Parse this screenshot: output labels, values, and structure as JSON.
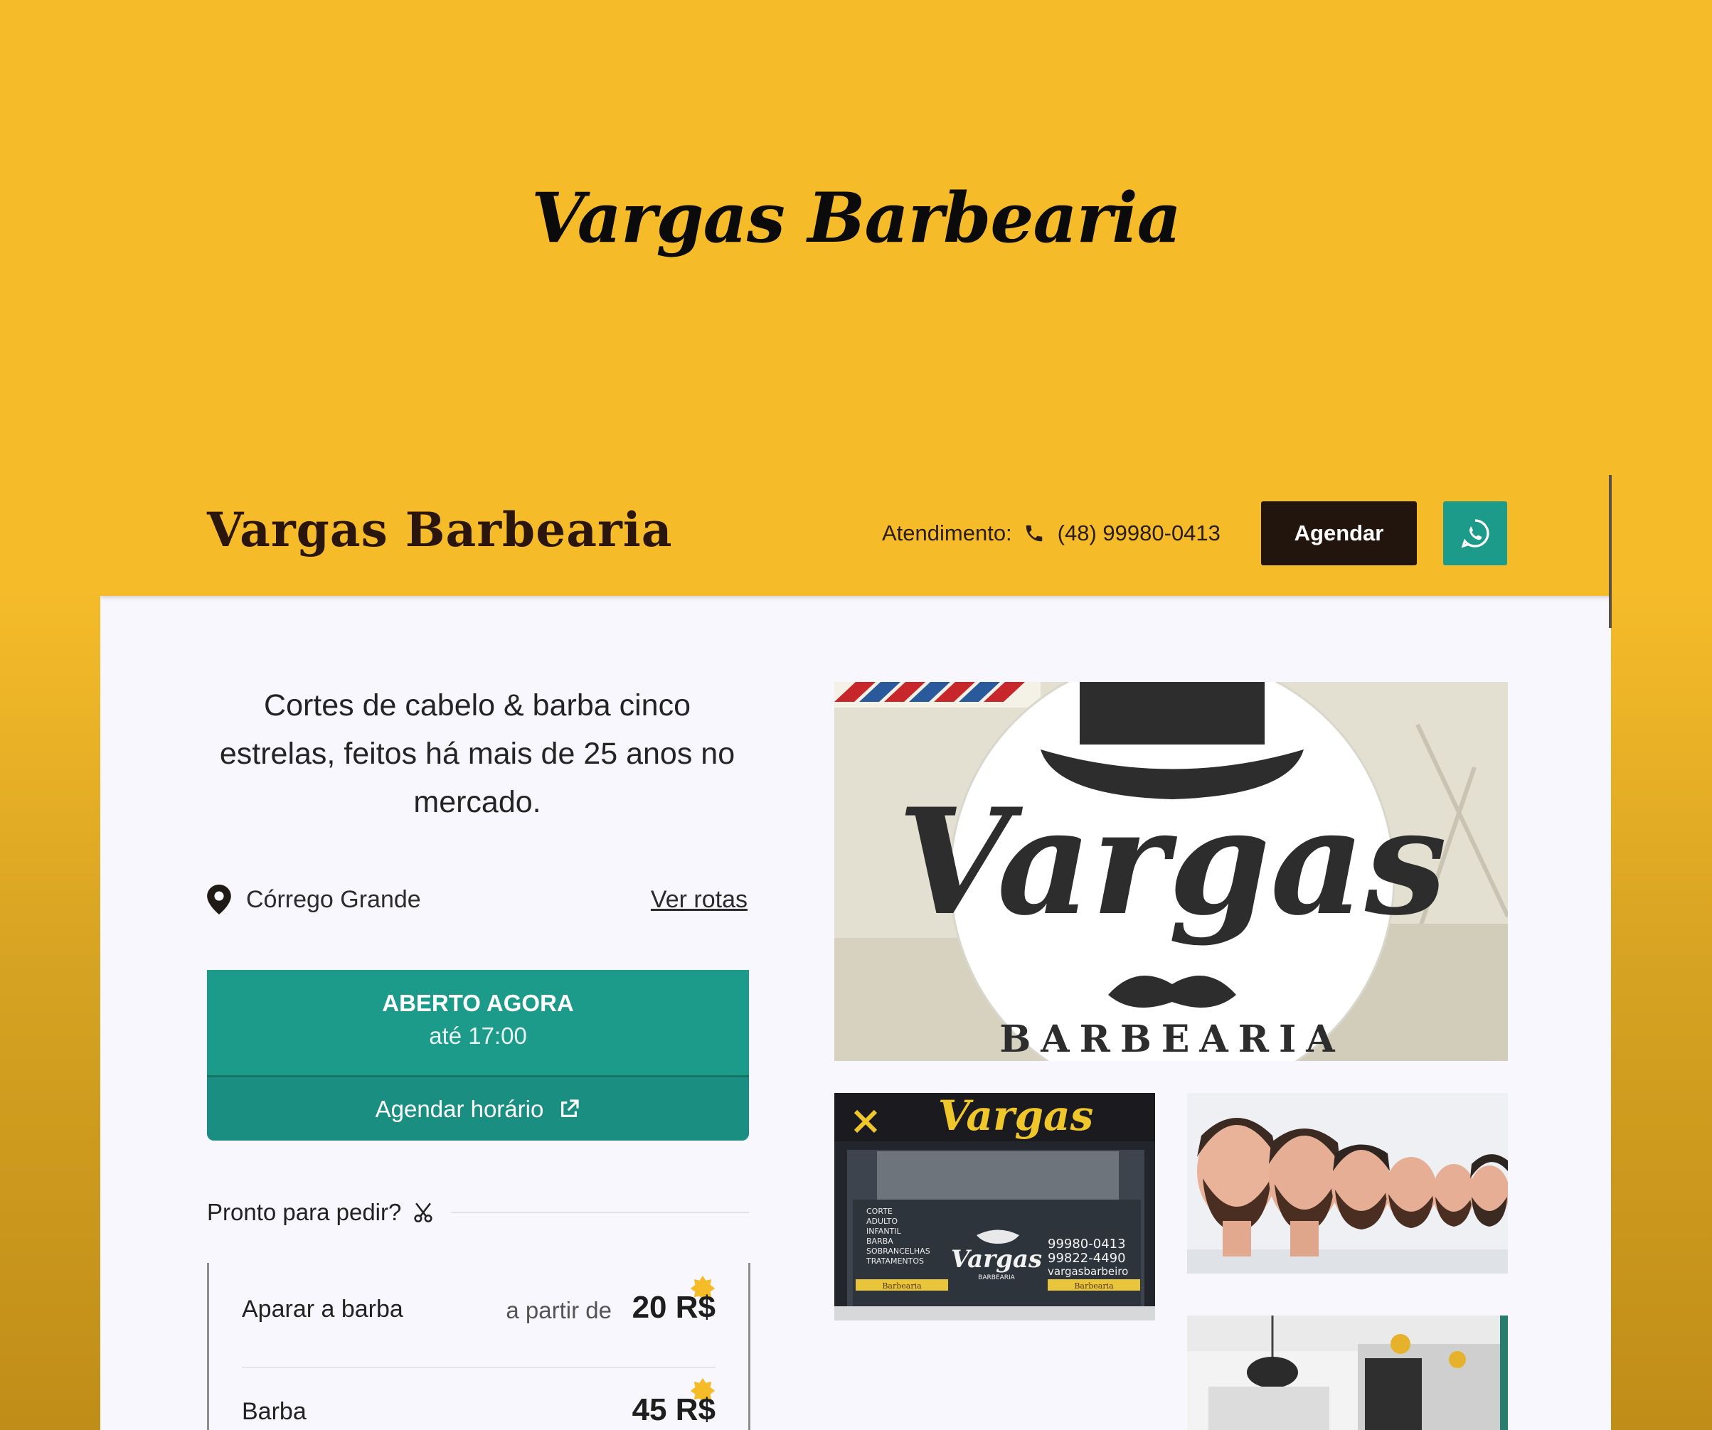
{
  "hero": {
    "title": "Vargas Barbearia"
  },
  "header": {
    "logo": "Vargas Barbearia",
    "contact_label": "Atendimento:",
    "phone": "(48) 99980-0413",
    "book_button": "Agendar",
    "whatsapp_icon": "whatsapp-icon"
  },
  "intro": {
    "tagline": "Cortes de cabelo & barba cinco estrelas, feitos há mais de 25 anos no mercado."
  },
  "location": {
    "name": "Córrego Grande",
    "routes_link": "Ver rotas"
  },
  "status": {
    "state": "ABERTO AGORA",
    "until": "até 17:00",
    "book_label": "Agendar horário"
  },
  "menu": {
    "heading": "Pronto para pedir?",
    "items": [
      {
        "name": "Aparar a barba",
        "prefix": "a partir de",
        "price": "20 R$"
      },
      {
        "name": "Barba",
        "prefix": "",
        "price": "45 R$"
      }
    ]
  },
  "gallery": {
    "logo_image": {
      "script": "Vargas",
      "ring": "BARBEARIA"
    },
    "storefront_image": {
      "sign": "Vargas",
      "window_logo": "Vargas",
      "window_sub": "BARBEARIA",
      "phones": [
        "99980-0413",
        "99822-4490"
      ],
      "handle": "vargasbarbeiro",
      "services": [
        "CORTE",
        "ADULTO",
        "INFANTIL",
        "BARBA",
        "SOBRANCELHAS",
        "TRATAMENTOS"
      ],
      "sticker": "Barbearia"
    }
  },
  "colors": {
    "brand_yellow": "#f5bb29",
    "dark_brown": "#21150e",
    "teal": "#1c9a8a",
    "page_bg": "#f8f7fd"
  }
}
